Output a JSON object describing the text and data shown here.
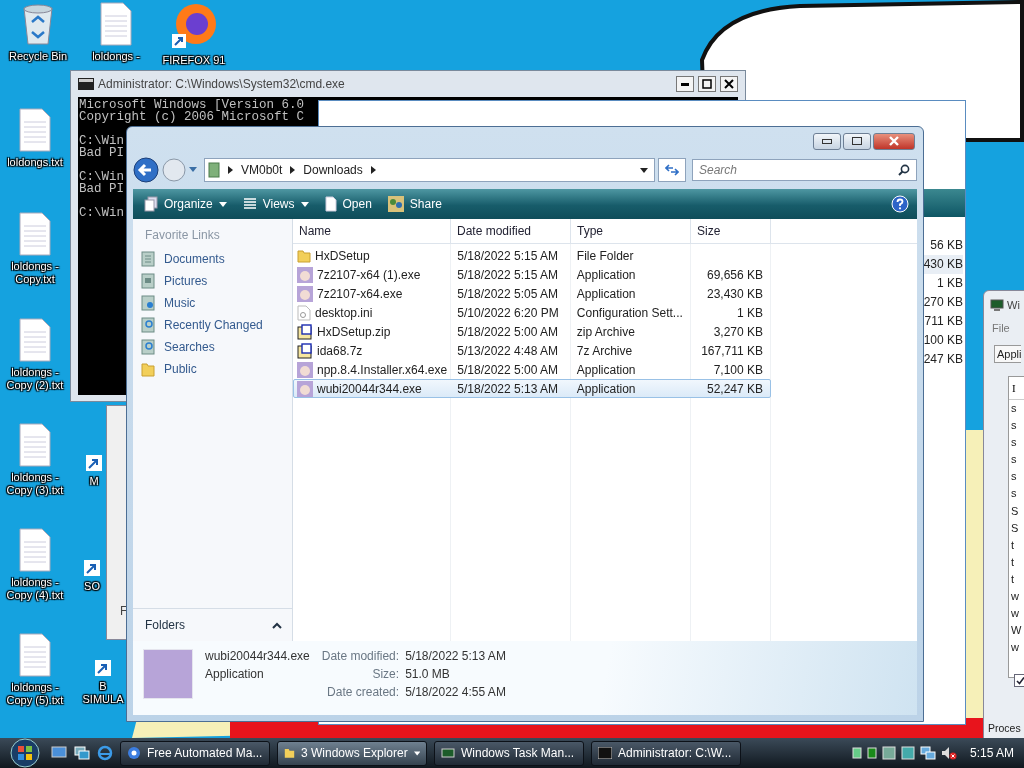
{
  "desktop_icons": [
    {
      "label": "Recycle Bin",
      "kind": "recycle"
    },
    {
      "label": "loldongs -",
      "kind": "text"
    },
    {
      "label": "FIREFOX 91",
      "kind": "browser"
    },
    {
      "label": "loldongs.txt",
      "kind": "text"
    },
    {
      "label": "loldongs - Copy.txt",
      "kind": "text"
    },
    {
      "label": "loldongs - Copy (2).txt",
      "kind": "text"
    },
    {
      "label": "loldongs - Copy (3).txt",
      "kind": "text"
    },
    {
      "label": "loldongs - Copy (4).txt",
      "kind": "text"
    },
    {
      "label": "loldongs - Copy (5).txt",
      "kind": "text"
    },
    {
      "label": "M",
      "kind": "shortcut"
    },
    {
      "label": "SO",
      "kind": "shortcut"
    },
    {
      "label": "B SIMULA",
      "kind": "shortcut"
    }
  ],
  "cmd_window": {
    "title": "Administrator: C:\\Windows\\System32\\cmd.exe",
    "blocks": [
      [
        "Microsoft Windows [Version 6.0",
        "Copyright (c) 2006 Microsoft C"
      ],
      [
        "C:\\Win",
        "Bad PI"
      ],
      [
        "C:\\Win",
        "Bad PI"
      ],
      [
        "C:\\Win"
      ]
    ]
  },
  "hidden_window": {
    "label": "F"
  },
  "back_explorer": {
    "sizes": [
      "56 KB",
      "430 KB",
      "1 KB",
      "270 KB",
      "711 KB",
      "100 KB",
      "247 KB"
    ]
  },
  "task_manager": {
    "title": "Wi",
    "menu": "File",
    "tab": "Appli",
    "column": "I",
    "rows": [
      "s",
      "s",
      "s",
      "s",
      "s",
      "s",
      "S",
      "S",
      "t",
      "t",
      "t",
      "w",
      "w",
      "W",
      "w"
    ],
    "checked": true,
    "status": "Proces"
  },
  "explorer": {
    "breadcrumb": [
      "VM0b0t",
      "Downloads"
    ],
    "search": {
      "placeholder": "Search"
    },
    "toolbar": [
      {
        "label": "Organize",
        "kind": "organize",
        "menu": true
      },
      {
        "label": "Views",
        "kind": "views",
        "menu": true
      },
      {
        "label": "Open",
        "kind": "open",
        "menu": false
      },
      {
        "label": "Share",
        "kind": "share",
        "menu": false
      }
    ],
    "favorites_title": "Favorite Links",
    "favorites": [
      {
        "label": "Documents",
        "kind": "documents"
      },
      {
        "label": "Pictures",
        "kind": "pictures"
      },
      {
        "label": "Music",
        "kind": "music"
      },
      {
        "label": "Recently Changed",
        "kind": "recent"
      },
      {
        "label": "Searches",
        "kind": "searches"
      },
      {
        "label": "Public",
        "kind": "folder"
      }
    ],
    "folders_label": "Folders",
    "columns": [
      "Name",
      "Date modified",
      "Type",
      "Size"
    ],
    "files": [
      {
        "name": "HxDSetup",
        "date": "5/18/2022 5:15 AM",
        "type": "File Folder",
        "kind": "folder",
        "selected": false
      },
      {
        "name": "7z2107-x64 (1).exe",
        "date": "5/18/2022 5:15 AM",
        "type": "Application",
        "size": "69,656 KB",
        "kind": "app",
        "selected": false
      },
      {
        "name": "7z2107-x64.exe",
        "date": "5/18/2022 5:05 AM",
        "type": "Application",
        "size": "23,430 KB",
        "kind": "app",
        "selected": false
      },
      {
        "name": "desktop.ini",
        "date": "5/10/2022 6:20 PM",
        "type": "Configuration Sett...",
        "size": "1 KB",
        "kind": "settings",
        "selected": false
      },
      {
        "name": "HxDSetup.zip",
        "date": "5/18/2022 5:00 AM",
        "type": "zip Archive",
        "size": "3,270 KB",
        "kind": "archive",
        "selected": false
      },
      {
        "name": "ida68.7z",
        "date": "5/13/2022 4:48 AM",
        "type": "7z Archive",
        "size": "167,711 KB",
        "kind": "archive",
        "selected": false
      },
      {
        "name": "npp.8.4.Installer.x64.exe",
        "date": "5/18/2022 5:00 AM",
        "type": "Application",
        "size": "7,100 KB",
        "kind": "app",
        "selected": false
      },
      {
        "name": "wubi20044r344.exe",
        "date": "5/18/2022 5:13 AM",
        "type": "Application",
        "size": "52,247 KB",
        "kind": "app",
        "selected": true
      }
    ],
    "details": {
      "name": "wubi20044r344.exe",
      "type": "Application",
      "fields": [
        {
          "label": "Date modified:",
          "value": "5/18/2022 5:13 AM"
        },
        {
          "label": "Size:",
          "value": "51.0 MB"
        },
        {
          "label": "Date created:",
          "value": "5/18/2022 4:55 AM"
        }
      ]
    }
  },
  "taskbar": {
    "tasks": [
      {
        "label": "Free Automated Ma...",
        "kind": "browser",
        "selected": false,
        "menu": false
      },
      {
        "label": "3 Windows Explorer",
        "kind": "folder",
        "selected": true,
        "menu": true
      },
      {
        "label": "Windows Task Man...",
        "kind": "monitor",
        "selected": false,
        "menu": false
      },
      {
        "label": "Administrator: C:\\W...",
        "kind": "console",
        "selected": false,
        "menu": false
      }
    ],
    "clock": "5:15 AM"
  }
}
